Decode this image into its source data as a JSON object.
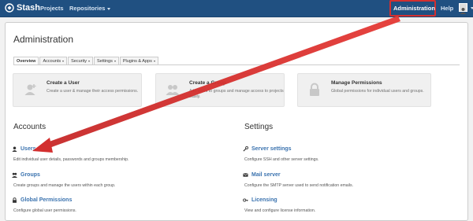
{
  "nav": {
    "brand": "Stash",
    "projects": "Projects",
    "repositories": "Repositories",
    "administration": "Administration",
    "help": "Help"
  },
  "page": {
    "title": "Administration",
    "tabs": [
      {
        "label": "Overview",
        "active": true
      },
      {
        "label": "Accounts",
        "active": false
      },
      {
        "label": "Security",
        "active": false
      },
      {
        "label": "Settings",
        "active": false
      },
      {
        "label": "Plugins & Apps",
        "active": false
      }
    ],
    "cards": [
      {
        "title": "Create a User",
        "desc": "Create a user & manage their access permissions.",
        "icon": "add-user-icon"
      },
      {
        "title": "Create a Group",
        "desc": "Add users to groups and manage access to projects easily.",
        "icon": "add-group-icon"
      },
      {
        "title": "Manage Permissions",
        "desc": "Global permissions for individual users and groups.",
        "icon": "lock-icon"
      }
    ],
    "accounts": {
      "heading": "Accounts",
      "items": [
        {
          "title": "Users",
          "desc": "Edit individual user details, passwords and groups membership.",
          "icon": "user-icon"
        },
        {
          "title": "Groups",
          "desc": "Create groups and manage the users within each group.",
          "icon": "group-icon"
        },
        {
          "title": "Global Permissions",
          "desc": "Configure global user permissions.",
          "icon": "lock-icon"
        }
      ]
    },
    "settings": {
      "heading": "Settings",
      "items": [
        {
          "title": "Server settings",
          "desc": "Configure SSH and other server settings.",
          "icon": "wrench-icon"
        },
        {
          "title": "Mail server",
          "desc": "Configure the SMTP server used to send notification emails.",
          "icon": "mail-icon"
        },
        {
          "title": "Licensing",
          "desc": "View and configure license information.",
          "icon": "key-icon"
        }
      ]
    }
  },
  "colors": {
    "nav_bg": "#205081",
    "link": "#3b73af",
    "highlight": "#d32f2f"
  }
}
